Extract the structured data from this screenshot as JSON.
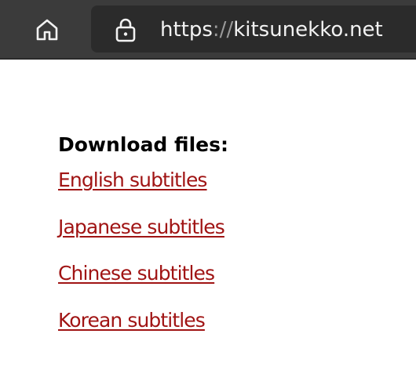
{
  "browser": {
    "home_icon": "home-icon",
    "lock_icon": "lock-icon",
    "url_scheme": "https",
    "url_separator": "://",
    "url_host": "kitsunekko.net"
  },
  "page": {
    "heading": "Download files:",
    "links": [
      {
        "label": "English subtitles"
      },
      {
        "label": "Japanese subtitles"
      },
      {
        "label": "Chinese subtitles"
      },
      {
        "label": "Korean subtitles"
      }
    ],
    "link_color": "#a01414"
  }
}
